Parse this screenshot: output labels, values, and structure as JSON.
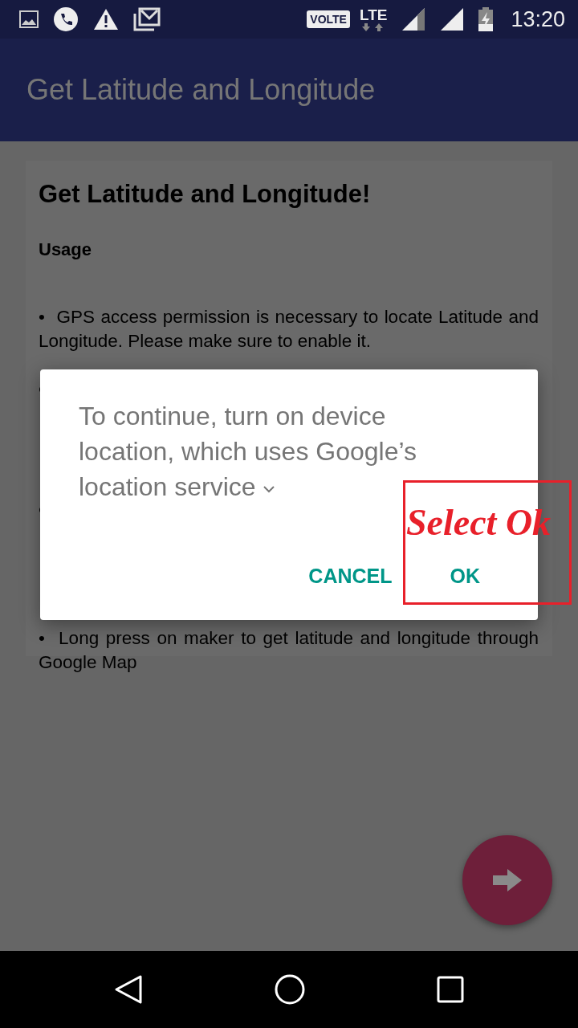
{
  "status_bar": {
    "time": "13:20",
    "network_badge": "VOLTE",
    "network_type": "LTE"
  },
  "app_bar": {
    "title": "Get Latitude and Longitude"
  },
  "card": {
    "heading": "Get Latitude and Longitude!",
    "subheading": "Usage",
    "items": [
      {
        "kind": "text",
        "text": "•  GPS access permission is necessary to locate Latitude and Longitude. Please make sure to enable it."
      },
      {
        "kind": "covered"
      },
      {
        "kind": "covered"
      },
      {
        "kind": "text",
        "text": "•  Long press on maker to get latitude and longitude through Google Map"
      }
    ]
  },
  "dialog": {
    "message": "To continue, turn on device location, which uses Google’s location service",
    "buttons": [
      "CANCEL",
      "OK"
    ]
  },
  "annotation": {
    "text": "Select Ok"
  }
}
